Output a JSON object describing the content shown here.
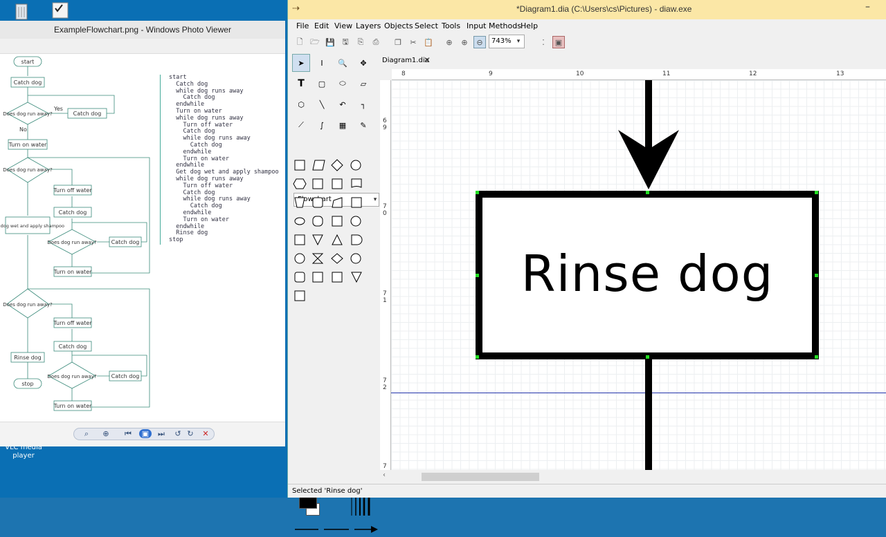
{
  "desktop": {
    "vlc_label": "VLC media player",
    "icons": [
      "recycle-bin-icon",
      "checkbox-icon"
    ]
  },
  "photo_viewer": {
    "title": "ExampleFlowchart.png - Windows Photo Viewer",
    "flowchart": {
      "nodes": {
        "start": "start",
        "catch1": "Catch dog",
        "dec1": "Does dog run away?",
        "catch_yes1": "Catch dog",
        "turn_on1": "Turn on water",
        "dec2": "Does dog run away?",
        "turn_off1": "Turn off water",
        "catch2": "Catch dog",
        "dec3": "Does dog run away?",
        "catch_yes3": "Catch dog",
        "turn_on2": "Turn on water",
        "get_wet": "Get dog wet and apply shampoo",
        "dec4": "Does dog run away?",
        "turn_off2": "Turn off water",
        "catch4": "Catch dog",
        "dec5": "Does dog run away?",
        "catch_yes5": "Catch dog",
        "turn_on3": "Turn on water",
        "rinse": "Rinse dog",
        "stop": "stop",
        "yes": "Yes",
        "no": "No"
      },
      "code": "start\n  Catch dog\n  while dog runs away\n    Catch dog\n  endwhile\n  Turn on water\n  while dog runs away\n    Turn off water\n    Catch dog\n    while dog runs away\n      Catch dog\n    endwhile\n    Turn on water\n  endwhile\n  Get dog wet and apply shampoo\n  while dog runs away\n    Turn off water\n    Catch dog\n    while dog runs away\n      Catch dog\n    endwhile\n    Turn on water\n  endwhile\n  Rinse dog\nstop"
    }
  },
  "dia": {
    "title": "*Diagram1.dia (C:\\Users\\cs\\Pictures) - diaw.exe",
    "menu": [
      "File",
      "Edit",
      "View",
      "Layers",
      "Objects",
      "Select",
      "Tools",
      "Input Methods",
      "Help"
    ],
    "zoom": "743%",
    "tab_label": "Diagram1.dia",
    "sheet": "Flowchart",
    "ruler_h": [
      "8",
      "9",
      "10",
      "11",
      "12",
      "13"
    ],
    "ruler_v": [
      "6",
      "9",
      "7",
      "0",
      "7",
      "1",
      "7",
      "2",
      "7"
    ],
    "selected_shape_text": "Rinse dog",
    "status": "Selected 'Rinse dog'",
    "colors": {
      "foreground": "#000000",
      "background": "#ffffff",
      "titlebar": "#fbe7a6",
      "guide": "#2233aa",
      "handle": "#22dd22"
    }
  }
}
